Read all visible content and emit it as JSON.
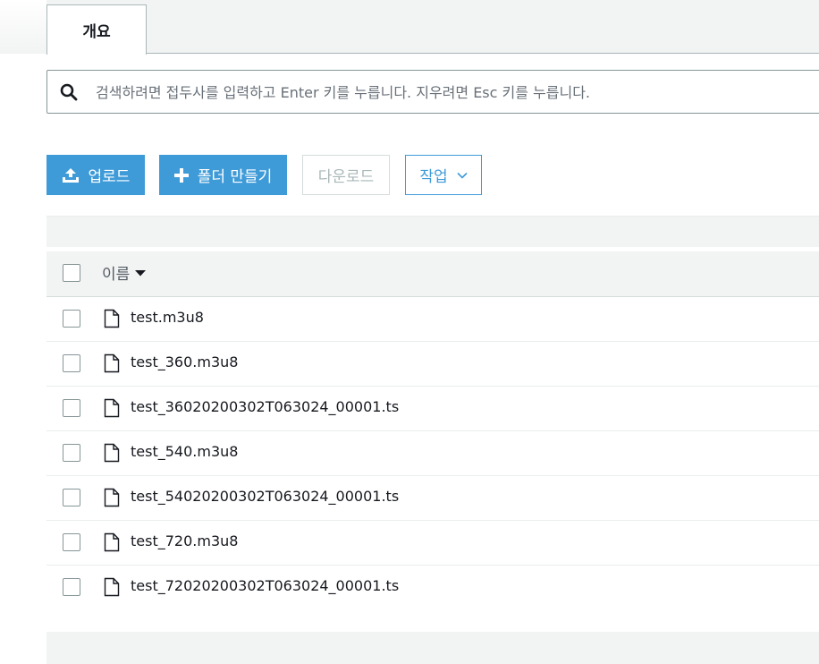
{
  "tabs": [
    {
      "label": "개요"
    }
  ],
  "search": {
    "placeholder": "검색하려면 접두사를 입력하고 Enter 키를 누릅니다. 지우려면 Esc 키를 누릅니다."
  },
  "toolbar": {
    "upload_label": "업로드",
    "create_folder_label": "폴더 만들기",
    "download_label": "다운로드",
    "actions_label": "작업"
  },
  "table": {
    "name_header": "이름",
    "sort": "descending",
    "rows": [
      {
        "name": "test.m3u8"
      },
      {
        "name": "test_360.m3u8"
      },
      {
        "name": "test_36020200302T063024_00001.ts"
      },
      {
        "name": "test_540.m3u8"
      },
      {
        "name": "test_54020200302T063024_00001.ts"
      },
      {
        "name": "test_720.m3u8"
      },
      {
        "name": "test_72020200302T063024_00001.ts"
      }
    ]
  },
  "icons": {
    "search": "search-icon",
    "upload": "upload-icon",
    "plus": "plus-icon",
    "chevron": "chevron-down-icon",
    "caret": "caret-down-icon",
    "file": "file-icon"
  },
  "colors": {
    "accent": "#3f9bd8",
    "text": "#16191f",
    "muted": "#687078"
  }
}
